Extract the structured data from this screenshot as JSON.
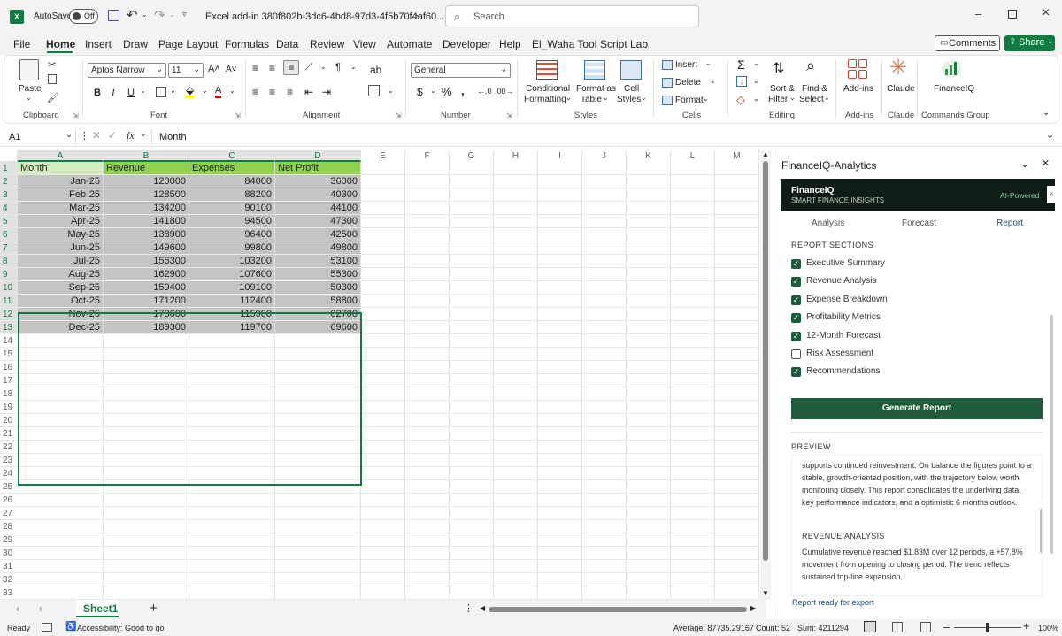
{
  "titlebar": {
    "autosave_label": "AutoSave",
    "autosave_state": "Off",
    "file_title": "Excel add-in 380f802b-3dc6-4bd8-97d3-4f5b70f4af60....",
    "search_placeholder": "Search"
  },
  "menu": {
    "items": [
      "File",
      "Home",
      "Insert",
      "Draw",
      "Page Layout",
      "Formulas",
      "Data",
      "Review",
      "View",
      "Automate",
      "Developer",
      "Help",
      "El_Waha Tool",
      "Script Lab"
    ],
    "active": "Home",
    "comments_label": "Comments",
    "share_label": "Share"
  },
  "ribbon": {
    "paste_label": "Paste",
    "clipboard_group": "Clipboard",
    "font_name": "Aptos Narrow",
    "font_size": "11",
    "font_group": "Font",
    "alignment_group": "Alignment",
    "number_format": "General",
    "number_group": "Number",
    "conditional_line1": "Conditional",
    "conditional_line2": "Formatting",
    "format_table_line1": "Format as",
    "format_table_line2": "Table",
    "cell_styles_line1": "Cell",
    "cell_styles_line2": "Styles",
    "styles_group": "Styles",
    "insert_label": "Insert",
    "delete_label": "Delete",
    "format_label": "Format",
    "cells_group": "Cells",
    "sort_line1": "Sort &",
    "sort_line2": "Filter",
    "find_line1": "Find &",
    "find_line2": "Select",
    "editing_group": "Editing",
    "addins_label": "Add-ins",
    "addins_group": "Add-ins",
    "claude_label": "Claude",
    "claude_group": "Claude",
    "financeiq_label": "FinanceIQ",
    "commands_group": "Commands Group"
  },
  "formula": {
    "name_box": "A1",
    "content": "Month"
  },
  "sheet": {
    "columns": [
      "A",
      "B",
      "C",
      "D",
      "E",
      "F",
      "G",
      "H",
      "I",
      "J",
      "K",
      "L",
      "M"
    ],
    "rows": [
      "1",
      "2",
      "3",
      "4",
      "5",
      "6",
      "7",
      "8",
      "9",
      "10",
      "11",
      "12",
      "13",
      "14",
      "15",
      "16",
      "17",
      "18",
      "19",
      "20",
      "21",
      "22",
      "23",
      "24",
      "25",
      "26",
      "27",
      "28",
      "29",
      "30",
      "31",
      "32",
      "33"
    ],
    "headers": [
      "Month",
      "Revenue",
      "Expenses",
      "Net Profit"
    ],
    "data": [
      [
        "Jan-25",
        "120000",
        "84000",
        "36000"
      ],
      [
        "Feb-25",
        "128500",
        "88200",
        "40300"
      ],
      [
        "Mar-25",
        "134200",
        "90100",
        "44100"
      ],
      [
        "Apr-25",
        "141800",
        "94500",
        "47300"
      ],
      [
        "May-25",
        "138900",
        "96400",
        "42500"
      ],
      [
        "Jun-25",
        "149600",
        "99800",
        "49800"
      ],
      [
        "Jul-25",
        "156300",
        "103200",
        "53100"
      ],
      [
        "Aug-25",
        "162900",
        "107600",
        "55300"
      ],
      [
        "Sep-25",
        "159400",
        "109100",
        "50300"
      ],
      [
        "Oct-25",
        "171200",
        "112400",
        "58800"
      ],
      [
        "Nov-25",
        "178600",
        "115900",
        "62700"
      ],
      [
        "Dec-25",
        "189300",
        "119700",
        "69600"
      ]
    ],
    "tab": "Sheet1"
  },
  "pane": {
    "title": "FinanceIQ-Analytics",
    "brand": "FinanceIQ",
    "tagline": "SMART FINANCE INSIGHTS",
    "badge": "AI-Powered",
    "tabs": [
      "Analysis",
      "Forecast",
      "Report"
    ],
    "active_tab": "Report",
    "sections_heading": "REPORT SECTIONS",
    "sections": [
      {
        "label": "Executive Summary",
        "checked": true
      },
      {
        "label": "Revenue Analysis",
        "checked": true
      },
      {
        "label": "Expense Breakdown",
        "checked": true
      },
      {
        "label": "Profitability Metrics",
        "checked": true
      },
      {
        "label": "12-Month Forecast",
        "checked": true
      },
      {
        "label": "Risk Assessment",
        "checked": false
      },
      {
        "label": "Recommendations",
        "checked": true
      }
    ],
    "generate_label": "Generate Report",
    "preview_heading": "PREVIEW",
    "preview_text1": "supports continued reinvestment. On balance the figures point to a stable, growth-oriented position, with the trajectory below worth monitoring closely. This report consolidates the underlying data, key performance indicators, and a optimistic 6 months outlook.",
    "preview_subheading": "REVENUE ANALYSIS",
    "preview_text2": "Cumulative revenue reached $1.83M over 12 periods, a +57.8% movement from opening to closing period. The trend reflects sustained top-line expansion.",
    "status": "Report ready for export"
  },
  "status": {
    "ready": "Ready",
    "accessibility": "Accessibility: Good to go",
    "average": "Average: 87735.29167",
    "count": "Count: 52",
    "sum": "Sum: 4211294",
    "zoom": "100%"
  },
  "colors": {
    "excel_green": "#107c41",
    "header_fill": "#92d050",
    "selection_fill": "#c4c4c4",
    "pane_dark": "#0e1d15",
    "button_green": "#1e5b3a",
    "accent_blue": "#1f4e79"
  }
}
